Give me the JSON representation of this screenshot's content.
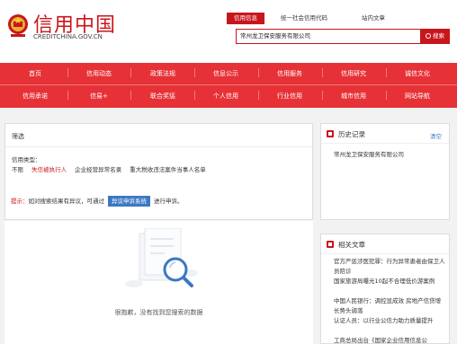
{
  "header": {
    "site_title": "信用中国",
    "site_domain": "CREDITCHINA.GOV.CN",
    "search_tabs": [
      "信用信息",
      "统一社会信用代码",
      "站内文章"
    ],
    "search_value": "常州龙卫保安服务有限公司",
    "search_button": "搜索"
  },
  "nav": {
    "row1": [
      "首页",
      "信用动态",
      "政策法规",
      "信息公示",
      "信用服务",
      "信用研究",
      "诚信文化"
    ],
    "row2": [
      "信用承诺",
      "信易+",
      "联合奖惩",
      "个人信用",
      "行业信用",
      "城市信用",
      "网站导航"
    ]
  },
  "filter": {
    "title": "筛选",
    "type_label": "信用类型：",
    "options": [
      "不限",
      "失信被执行人",
      "企业经营异常名录",
      "重大税收违法案件当事人名单"
    ]
  },
  "tip": {
    "label": "提示：",
    "text": "如对搜索结果有异议，可通过",
    "button": "异议申诉系统",
    "suffix": "进行申诉。"
  },
  "result": {
    "empty_text": "很抱歉，没有找到您搜索的数据"
  },
  "history": {
    "title": "历史记录",
    "clear": "清空",
    "items": [
      "常州龙卫保安服务有限公司"
    ]
  },
  "related": {
    "title": "相关文章",
    "items": [
      "官方严惩涉医犯罪：行为异常患者由保卫人员陪诊",
      "国家旅游局曝光10起不合理低价游案例",
      "中国人民银行：调控显成效 房地产信贷增长势头弱落",
      "认证人员：以行业公信力助力质量提升",
      "工商总局出台《国家企业信用信息公"
    ]
  },
  "colors": {
    "brand_red": "#c8161d",
    "nav_red": "#e63237",
    "link_blue": "#3b78c3"
  }
}
